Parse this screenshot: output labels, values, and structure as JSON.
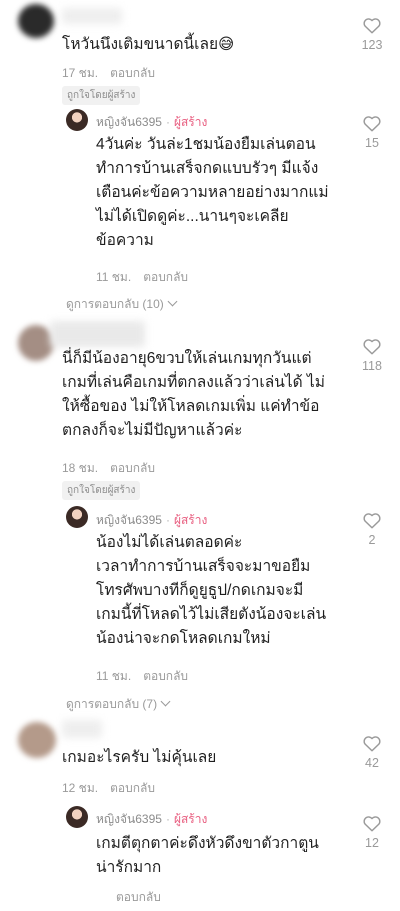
{
  "colors": {
    "creator": "#e85d7f",
    "meta": "#9a9a9a",
    "text": "#1f1f1f"
  },
  "comments": [
    {
      "text_lines": [
        "โหวันนึงเติมขนาดนี้เลย😅"
      ],
      "time": "17 ชม.",
      "reply_label": "ตอบกลับ",
      "liked_by_creator": "ถูกใจโดยผู้สร้าง",
      "likes": "123",
      "reply": {
        "username": "หญิงจัน6395",
        "separator": "·",
        "creator_badge": "ผู้สร้าง",
        "text_lines": [
          "4วันค่ะ วันล่ะ1ชมน้องยืมเล่นตอน",
          "ทำการบ้านเสร็จกดแบบรัวๆ มีแจ้ง",
          "เตือนค่ะข้อความหลายอย่างมากแม่",
          "ไม่ได้เปิดดูค่ะ...นานๆจะเคลีย",
          "ข้อความ"
        ],
        "time": "11 ชม.",
        "reply_label": "ตอบกลับ",
        "likes": "15"
      },
      "view_replies": "ดูการตอบกลับ (10)"
    },
    {
      "text_lines": [
        "นี่ก็มีน้องอายุ6ขวบให้เล่นเกมทุกวันแต่",
        "เกมที่เล่นคือเกมที่ตกลงแล้วว่าเล่นได้ ไม่",
        "ให้ซื้อของ ไม่ให้โหลดเกมเพิ่ม แค่ทำข้อ",
        "ตกลงก็จะไม่มีปัญหาแล้วค่ะ"
      ],
      "time": "18 ชม.",
      "reply_label": "ตอบกลับ",
      "liked_by_creator": "ถูกใจโดยผู้สร้าง",
      "likes": "118",
      "reply": {
        "username": "หญิงจัน6395",
        "separator": "·",
        "creator_badge": "ผู้สร้าง",
        "text_lines": [
          "น้องไม่ได้เล่นตลอดค่ะ",
          "เวลาทำการบ้านเสร็จจะมาขอยืม",
          "โทรศัพบางทีก็ดูยูธูป/กดเกมจะมี",
          "เกมนี้ที่โหลดไว้ไม่เสียตังน้องจะเล่น",
          "น้องน่าจะกดโหลดเกมใหม่"
        ],
        "time": "11 ชม.",
        "reply_label": "ตอบกลับ",
        "likes": "2"
      },
      "view_replies": "ดูการตอบกลับ (7)"
    },
    {
      "text_lines": [
        "เกมอะไรครับ ไม่คุ้นเลย"
      ],
      "time": "12 ชม.",
      "reply_label": "ตอบกลับ",
      "likes": "42",
      "reply": {
        "username": "หญิงจัน6395",
        "separator": "·",
        "creator_badge": "ผู้สร้าง",
        "text_lines": [
          "เกมตีตุกตาค่ะดึงหัวดึงขาตัวกาตูน",
          "น่ารักมาก"
        ],
        "time": "",
        "reply_label": "ตอบกลับ",
        "likes": "12"
      }
    }
  ]
}
